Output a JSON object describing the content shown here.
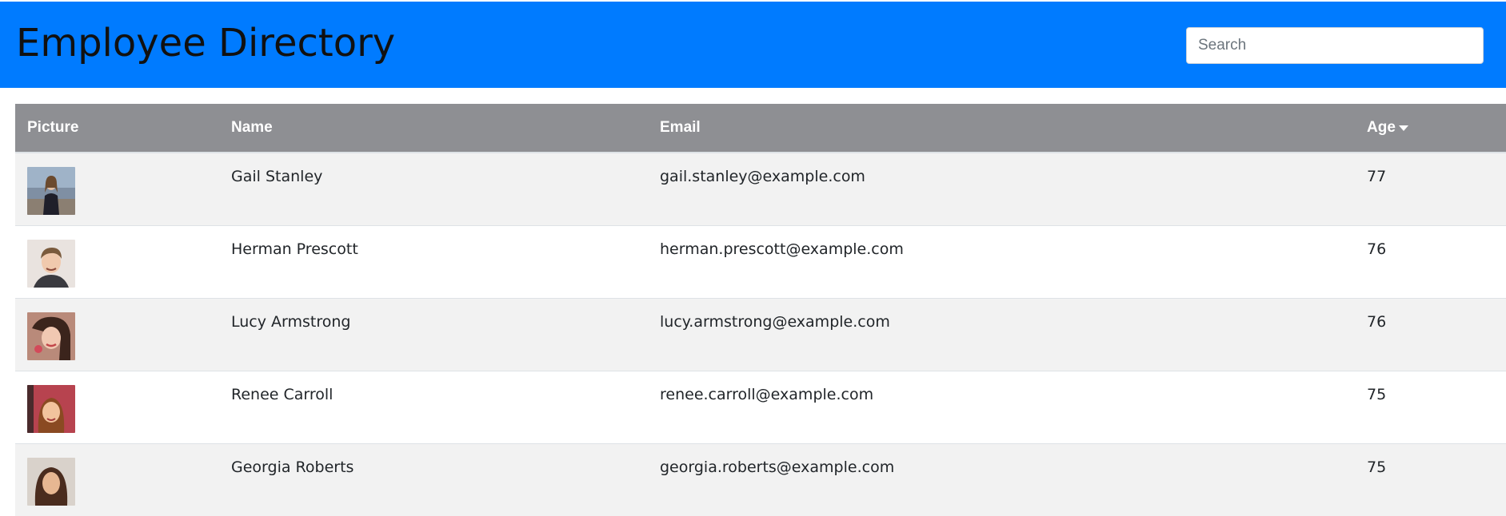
{
  "header": {
    "title": "Employee Directory",
    "search_placeholder": "Search",
    "search_value": "",
    "background": "#007bff"
  },
  "table": {
    "columns": [
      {
        "label": "Picture"
      },
      {
        "label": "Name"
      },
      {
        "label": "Email"
      },
      {
        "label": "Age",
        "sort_icon": "caret-down-icon",
        "sort_direction": "descending"
      }
    ],
    "header_background": "#8e8f93",
    "stripe_color": "#f2f2f2",
    "rows": [
      {
        "name": "Gail Stanley",
        "email": "gail.stanley@example.com",
        "age": "77",
        "picture": "avatar-gail-stanley"
      },
      {
        "name": "Herman Prescott",
        "email": "herman.prescott@example.com",
        "age": "76",
        "picture": "avatar-herman-prescott"
      },
      {
        "name": "Lucy Armstrong",
        "email": "lucy.armstrong@example.com",
        "age": "76",
        "picture": "avatar-lucy-armstrong"
      },
      {
        "name": "Renee Carroll",
        "email": "renee.carroll@example.com",
        "age": "75",
        "picture": "avatar-renee-carroll"
      },
      {
        "name": "Georgia Roberts",
        "email": "georgia.roberts@example.com",
        "age": "75",
        "picture": "avatar-georgia-roberts"
      }
    ]
  }
}
